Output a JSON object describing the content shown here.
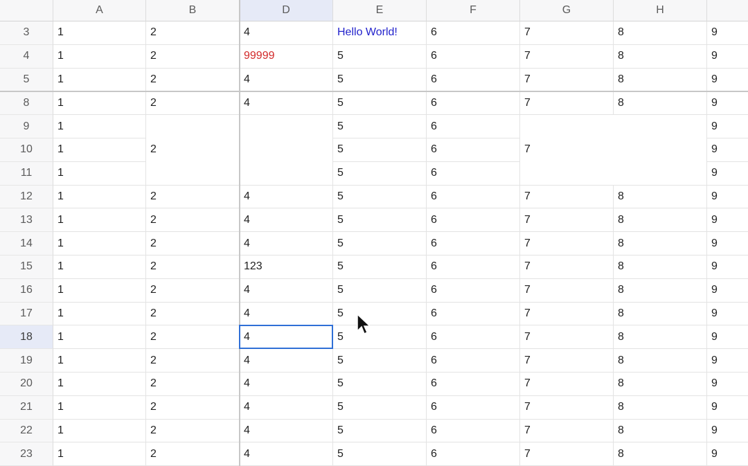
{
  "sheet": {
    "columns": [
      {
        "key": "A",
        "label": "A"
      },
      {
        "key": "B",
        "label": "B"
      },
      {
        "key": "D",
        "label": "D"
      },
      {
        "key": "E",
        "label": "E"
      },
      {
        "key": "F",
        "label": "F"
      },
      {
        "key": "G",
        "label": "G"
      },
      {
        "key": "H",
        "label": "H"
      },
      {
        "key": "I",
        "label": ""
      }
    ],
    "active_column": "D",
    "active_row": "18",
    "rows": [
      {
        "num": "3",
        "cells": [
          "1",
          "2",
          "4",
          "Hello World!",
          "6",
          "7",
          "8",
          "9"
        ]
      },
      {
        "num": "4",
        "cells": [
          "1",
          "2",
          "99999",
          "5",
          "6",
          "7",
          "8",
          "9"
        ]
      },
      {
        "num": "5",
        "cells": [
          "1",
          "2",
          "4",
          "5",
          "6",
          "7",
          "8",
          "9"
        ]
      },
      {
        "num": "8",
        "cells": [
          "1",
          "2",
          "4",
          "5",
          "6",
          "7",
          "8",
          "9"
        ]
      },
      {
        "num": "9",
        "cells": [
          "1",
          "",
          "",
          "5",
          "6",
          "",
          "",
          "9"
        ]
      },
      {
        "num": "10",
        "cells": [
          "1",
          "2",
          "",
          "5",
          "6",
          "7",
          "",
          "9"
        ]
      },
      {
        "num": "11",
        "cells": [
          "1",
          "",
          "",
          "5",
          "6",
          "",
          "",
          "9"
        ]
      },
      {
        "num": "12",
        "cells": [
          "1",
          "2",
          "4",
          "5",
          "6",
          "7",
          "8",
          "9"
        ]
      },
      {
        "num": "13",
        "cells": [
          "1",
          "2",
          "4",
          "5",
          "6",
          "7",
          "8",
          "9"
        ]
      },
      {
        "num": "14",
        "cells": [
          "1",
          "2",
          "4",
          "5",
          "6",
          "7",
          "8",
          "9"
        ]
      },
      {
        "num": "15",
        "cells": [
          "1",
          "2",
          "123",
          "5",
          "6",
          "7",
          "8",
          "9"
        ]
      },
      {
        "num": "16",
        "cells": [
          "1",
          "2",
          "4",
          "5",
          "6",
          "7",
          "8",
          "9"
        ]
      },
      {
        "num": "17",
        "cells": [
          "1",
          "2",
          "4",
          "5",
          "6",
          "7",
          "8",
          "9"
        ]
      },
      {
        "num": "18",
        "cells": [
          "1",
          "2",
          "4",
          "5",
          "6",
          "7",
          "8",
          "9"
        ]
      },
      {
        "num": "19",
        "cells": [
          "1",
          "2",
          "4",
          "5",
          "6",
          "7",
          "8",
          "9"
        ]
      },
      {
        "num": "20",
        "cells": [
          "1",
          "2",
          "4",
          "5",
          "6",
          "7",
          "8",
          "9"
        ]
      },
      {
        "num": "21",
        "cells": [
          "1",
          "2",
          "4",
          "5",
          "6",
          "7",
          "8",
          "9"
        ]
      },
      {
        "num": "22",
        "cells": [
          "1",
          "2",
          "4",
          "5",
          "6",
          "7",
          "8",
          "9"
        ]
      },
      {
        "num": "23",
        "cells": [
          "1",
          "2",
          "4",
          "5",
          "6",
          "7",
          "8",
          "9"
        ]
      }
    ],
    "styled_cells": {
      "3-E": "blue",
      "4-D": "red"
    },
    "selected_cell": "D18",
    "hidden_columns_marker": "after-B",
    "hidden_rows_marker": "after-5",
    "icons": {
      "cursor": "mouse-pointer-icon"
    },
    "colors": {
      "selection": "#2f6fd6",
      "link_text": "#2222cc",
      "error_text": "#d22a2a",
      "active_header": "#e6eaf7"
    }
  }
}
